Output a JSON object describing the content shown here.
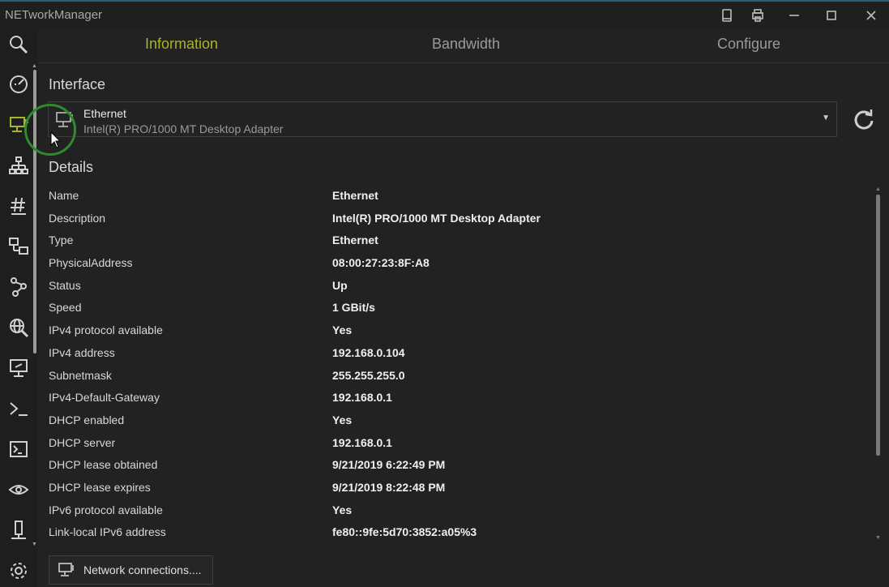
{
  "window": {
    "title": "NETworkManager"
  },
  "tabs": [
    {
      "label": "Information",
      "active": true
    },
    {
      "label": "Bandwidth",
      "active": false
    },
    {
      "label": "Configure",
      "active": false
    }
  ],
  "sidebar": {
    "items": [
      {
        "icon": "search-icon"
      },
      {
        "icon": "speedometer-icon"
      },
      {
        "icon": "network-interface-icon",
        "active": true
      },
      {
        "icon": "network-tree-icon"
      },
      {
        "icon": "hash-icon"
      },
      {
        "icon": "connected-computers-icon"
      },
      {
        "icon": "route-icon"
      },
      {
        "icon": "globe-search-icon"
      },
      {
        "icon": "remote-desktop-icon"
      },
      {
        "icon": "prompt-icon"
      },
      {
        "icon": "terminal-icon"
      },
      {
        "icon": "eye-icon"
      },
      {
        "icon": "server-icon"
      },
      {
        "icon": "gear-icon"
      }
    ]
  },
  "interface": {
    "section_title": "Interface",
    "selected_name": "Ethernet",
    "selected_description": "Intel(R) PRO/1000 MT Desktop Adapter"
  },
  "details": {
    "section_title": "Details",
    "rows": [
      {
        "key": "Name",
        "value": "Ethernet"
      },
      {
        "key": "Description",
        "value": "Intel(R) PRO/1000 MT Desktop Adapter"
      },
      {
        "key": "Type",
        "value": "Ethernet"
      },
      {
        "key": "PhysicalAddress",
        "value": "08:00:27:23:8F:A8"
      },
      {
        "key": "Status",
        "value": "Up"
      },
      {
        "key": "Speed",
        "value": "1 GBit/s"
      },
      {
        "key": "IPv4 protocol available",
        "value": "Yes"
      },
      {
        "key": "IPv4 address",
        "value": "192.168.0.104"
      },
      {
        "key": "Subnetmask",
        "value": "255.255.255.0"
      },
      {
        "key": "IPv4-Default-Gateway",
        "value": "192.168.0.1"
      },
      {
        "key": "DHCP enabled",
        "value": "Yes"
      },
      {
        "key": "DHCP server",
        "value": "192.168.0.1"
      },
      {
        "key": "DHCP lease obtained",
        "value": "9/21/2019 6:22:49 PM"
      },
      {
        "key": "DHCP lease expires",
        "value": "9/21/2019 8:22:48 PM"
      },
      {
        "key": "IPv6 protocol available",
        "value": "Yes"
      },
      {
        "key": "Link-local IPv6 address",
        "value": "fe80::9fe:5d70:3852:a05%3"
      }
    ]
  },
  "footer": {
    "network_connections_label": "Network connections...."
  },
  "colors": {
    "accent": "#a9b42a",
    "background": "#222222",
    "highlight_ring": "#2f8a2c"
  }
}
